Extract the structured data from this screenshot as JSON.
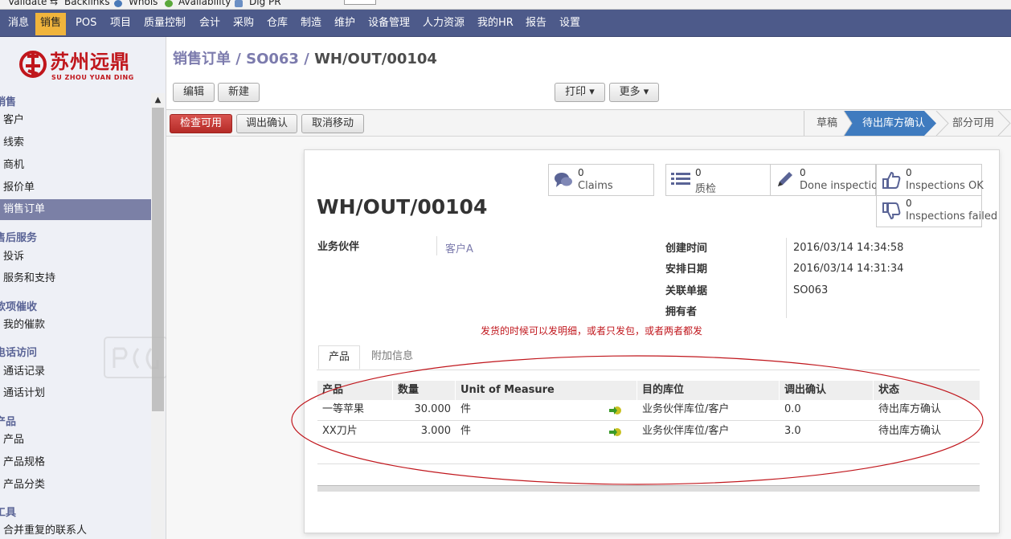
{
  "bookmarks": [
    "Validate",
    "Backlinks",
    "Whois",
    "Availability",
    "Dig PR"
  ],
  "topnav": [
    "消息",
    "销售",
    "POS",
    "项目",
    "质量控制",
    "会计",
    "采购",
    "仓库",
    "制造",
    "维护",
    "设备管理",
    "人力资源",
    "我的HR",
    "报告",
    "设置"
  ],
  "topnav_active": "销售",
  "logo": {
    "cn": "苏州远鼎",
    "en": "SU ZHOU YUAN DING"
  },
  "sidebar": {
    "sections": [
      {
        "title": "销售",
        "items": [
          "客户",
          "线索",
          "商机",
          "报价单",
          "销售订单"
        ]
      },
      {
        "title": "售后服务",
        "items": [
          "投诉",
          "服务和支持"
        ]
      },
      {
        "title": "款项催收",
        "items": [
          "我的催款"
        ]
      },
      {
        "title": "电话访问",
        "items": [
          "通话记录",
          "通话计划"
        ]
      },
      {
        "title": "产品",
        "items": [
          "产品",
          "产品规格",
          "产品分类"
        ]
      },
      {
        "title": "工具",
        "items": [
          "合并重复的联系人"
        ]
      }
    ],
    "active_item": "销售订单"
  },
  "breadcrumb": {
    "root": "销售订单",
    "sep": " / ",
    "mid": "SO063",
    "current": "WH/OUT/00104"
  },
  "toolbar": {
    "edit": "编辑",
    "create": "新建",
    "print": "打印 ▾",
    "more": "更多 ▾"
  },
  "actions": {
    "check": "检查可用",
    "confirm": "调出确认",
    "cancel": "取消移动"
  },
  "status_steps": [
    "草稿",
    "待出库方确认",
    "部分可用"
  ],
  "status_active": "待出库方确认",
  "stats": [
    {
      "count": "0",
      "label": "Claims",
      "icon": "comments-icon"
    },
    {
      "count": "0",
      "label": "质检",
      "icon": "list-icon"
    },
    {
      "count": "0",
      "label": "Done inspections",
      "icon": "pencil-icon"
    },
    {
      "count": "0",
      "label": "Inspections OK",
      "icon": "thumbs-up-icon"
    },
    {
      "count": "0",
      "label": "Inspections failed",
      "icon": "thumbs-down-icon"
    }
  ],
  "record": {
    "title": "WH/OUT/00104",
    "partner_label": "业务伙伴",
    "partner_value": "客户A",
    "created_label": "创建时间",
    "created_value": "2016/03/14 14:34:58",
    "scheduled_label": "安排日期",
    "scheduled_value": "2016/03/14 14:31:34",
    "source_label": "关联单据",
    "source_value": "SO063",
    "owner_label": "拥有者",
    "owner_value": ""
  },
  "annotation": "发货的时候可以发明细，或者只发包，或者两者都发",
  "tabs": [
    "产品",
    "附加信息"
  ],
  "table": {
    "headers": [
      "产品",
      "数量",
      "Unit of Measure",
      "目的库位",
      "调出确认",
      "状态"
    ],
    "rows": [
      {
        "product": "一等苹果",
        "qty": "30.000",
        "uom": "件",
        "dest": "业务伙伴库位/客户",
        "confirm": "0.0",
        "state": "待出库方确认"
      },
      {
        "product": "XX刀片",
        "qty": "3.000",
        "uom": "件",
        "dest": "业务伙伴库位/客户",
        "confirm": "3.0",
        "state": "待出库方确认"
      }
    ]
  },
  "colors": {
    "nav": "#4d5a8a",
    "nav_active": "#f0b43c",
    "accent": "#7c7bad",
    "step_active": "#3f7bbf",
    "primary_btn": "#c9302c",
    "annotation": "#c0161c"
  }
}
